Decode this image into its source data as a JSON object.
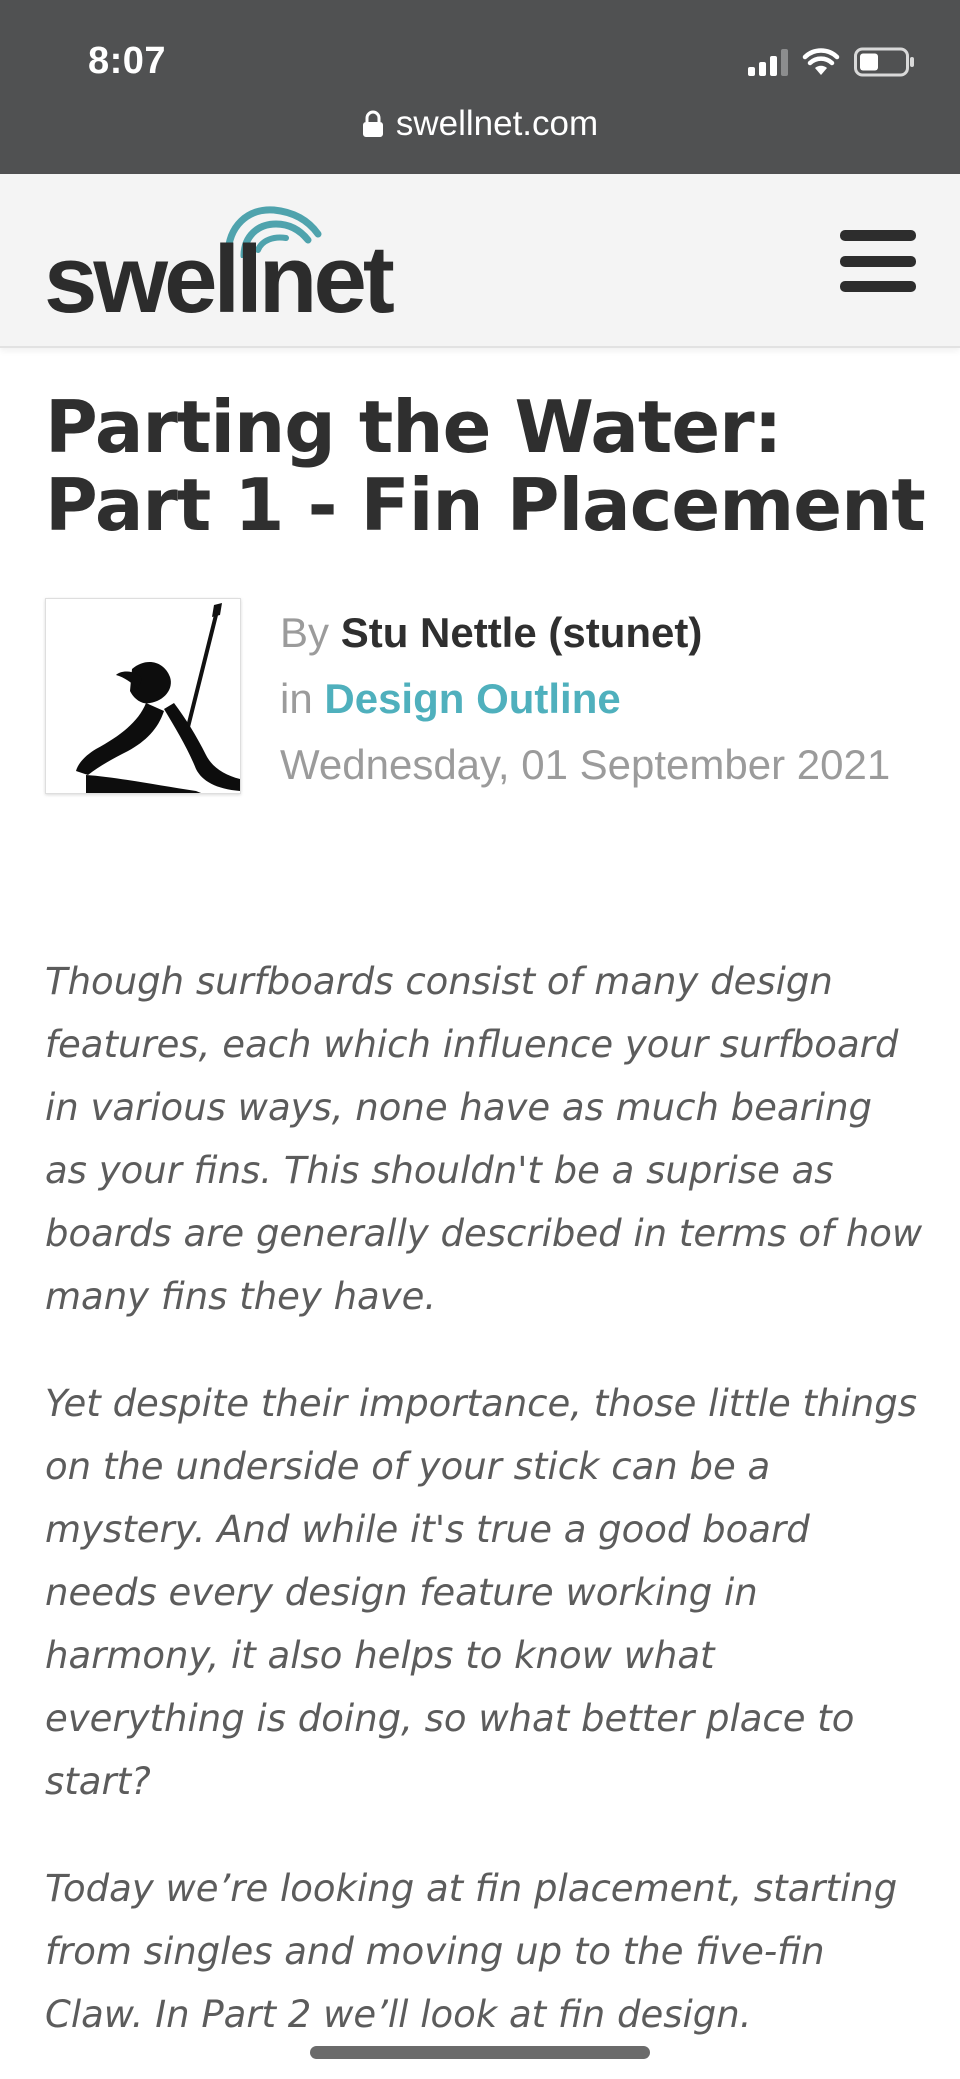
{
  "status_bar": {
    "time": "8:07",
    "icons": [
      "cellular-signal-icon",
      "wifi-icon",
      "battery-icon"
    ]
  },
  "url_bar": {
    "domain": "swellnet.com",
    "icon": "lock-icon"
  },
  "site_header": {
    "logo_text": "swellnet",
    "brand_color": "#4fa3ad",
    "menu_icon": "hamburger-menu-icon"
  },
  "article": {
    "title": "Parting the Water: Part 1 - Fin Placement",
    "byline_prefix": "By",
    "author": "Stu Nettle (stunet)",
    "category_prefix": "in",
    "category": "Design Outline",
    "category_color": "#4fb0bd",
    "date": "Wednesday, 01 September 2021",
    "paragraphs": [
      "Though surfboards consist of many design features, each which influence your surfboard in various ways, none have as much bearing as your fins. This shouldn't be a suprise as boards are generally described in terms of how many fins they have.",
      "Yet despite their importance, those little things on the underside of your stick can be a mystery. And while it's true a good board needs every design feature working in harmony, it also helps to know what everything is doing, so what better place to start?",
      "Today we’re looking at fin placement, starting from singles and moving up to the five-fin Claw. In Part 2 we’ll look at fin design."
    ]
  }
}
